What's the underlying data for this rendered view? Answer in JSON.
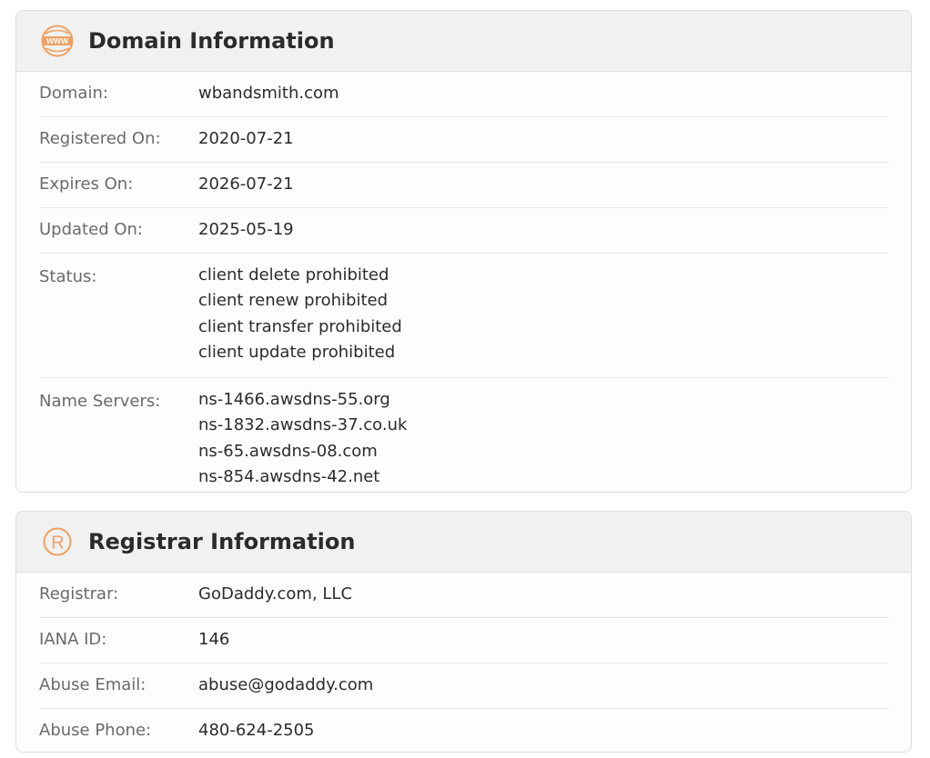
{
  "domain_card": {
    "title": "Domain Information",
    "icon": "www-icon",
    "rows": [
      {
        "label": "Domain:",
        "value": "wbandsmith.com"
      },
      {
        "label": "Registered On:",
        "value": "2020-07-21"
      },
      {
        "label": "Expires On:",
        "value": "2026-07-21"
      },
      {
        "label": "Updated On:",
        "value": "2025-05-19"
      }
    ],
    "status": {
      "label": "Status:",
      "values": [
        "client delete prohibited",
        "client renew prohibited",
        "client transfer prohibited",
        "client update prohibited"
      ]
    },
    "name_servers": {
      "label": "Name Servers:",
      "values": [
        "ns-1466.awsdns-55.org",
        "ns-1832.awsdns-37.co.uk",
        "ns-65.awsdns-08.com",
        "ns-854.awsdns-42.net"
      ]
    }
  },
  "registrar_card": {
    "title": "Registrar Information",
    "icon": "registered-icon",
    "rows": [
      {
        "label": "Registrar:",
        "value": "GoDaddy.com, LLC"
      },
      {
        "label": "IANA ID:",
        "value": "146"
      },
      {
        "label": "Abuse Email:",
        "value": "abuse@godaddy.com"
      },
      {
        "label": "Abuse Phone:",
        "value": "480-624-2505"
      }
    ]
  },
  "colors": {
    "accent": "#f0a060",
    "header_bg": "#f1f1f1",
    "border": "#dddddd"
  }
}
